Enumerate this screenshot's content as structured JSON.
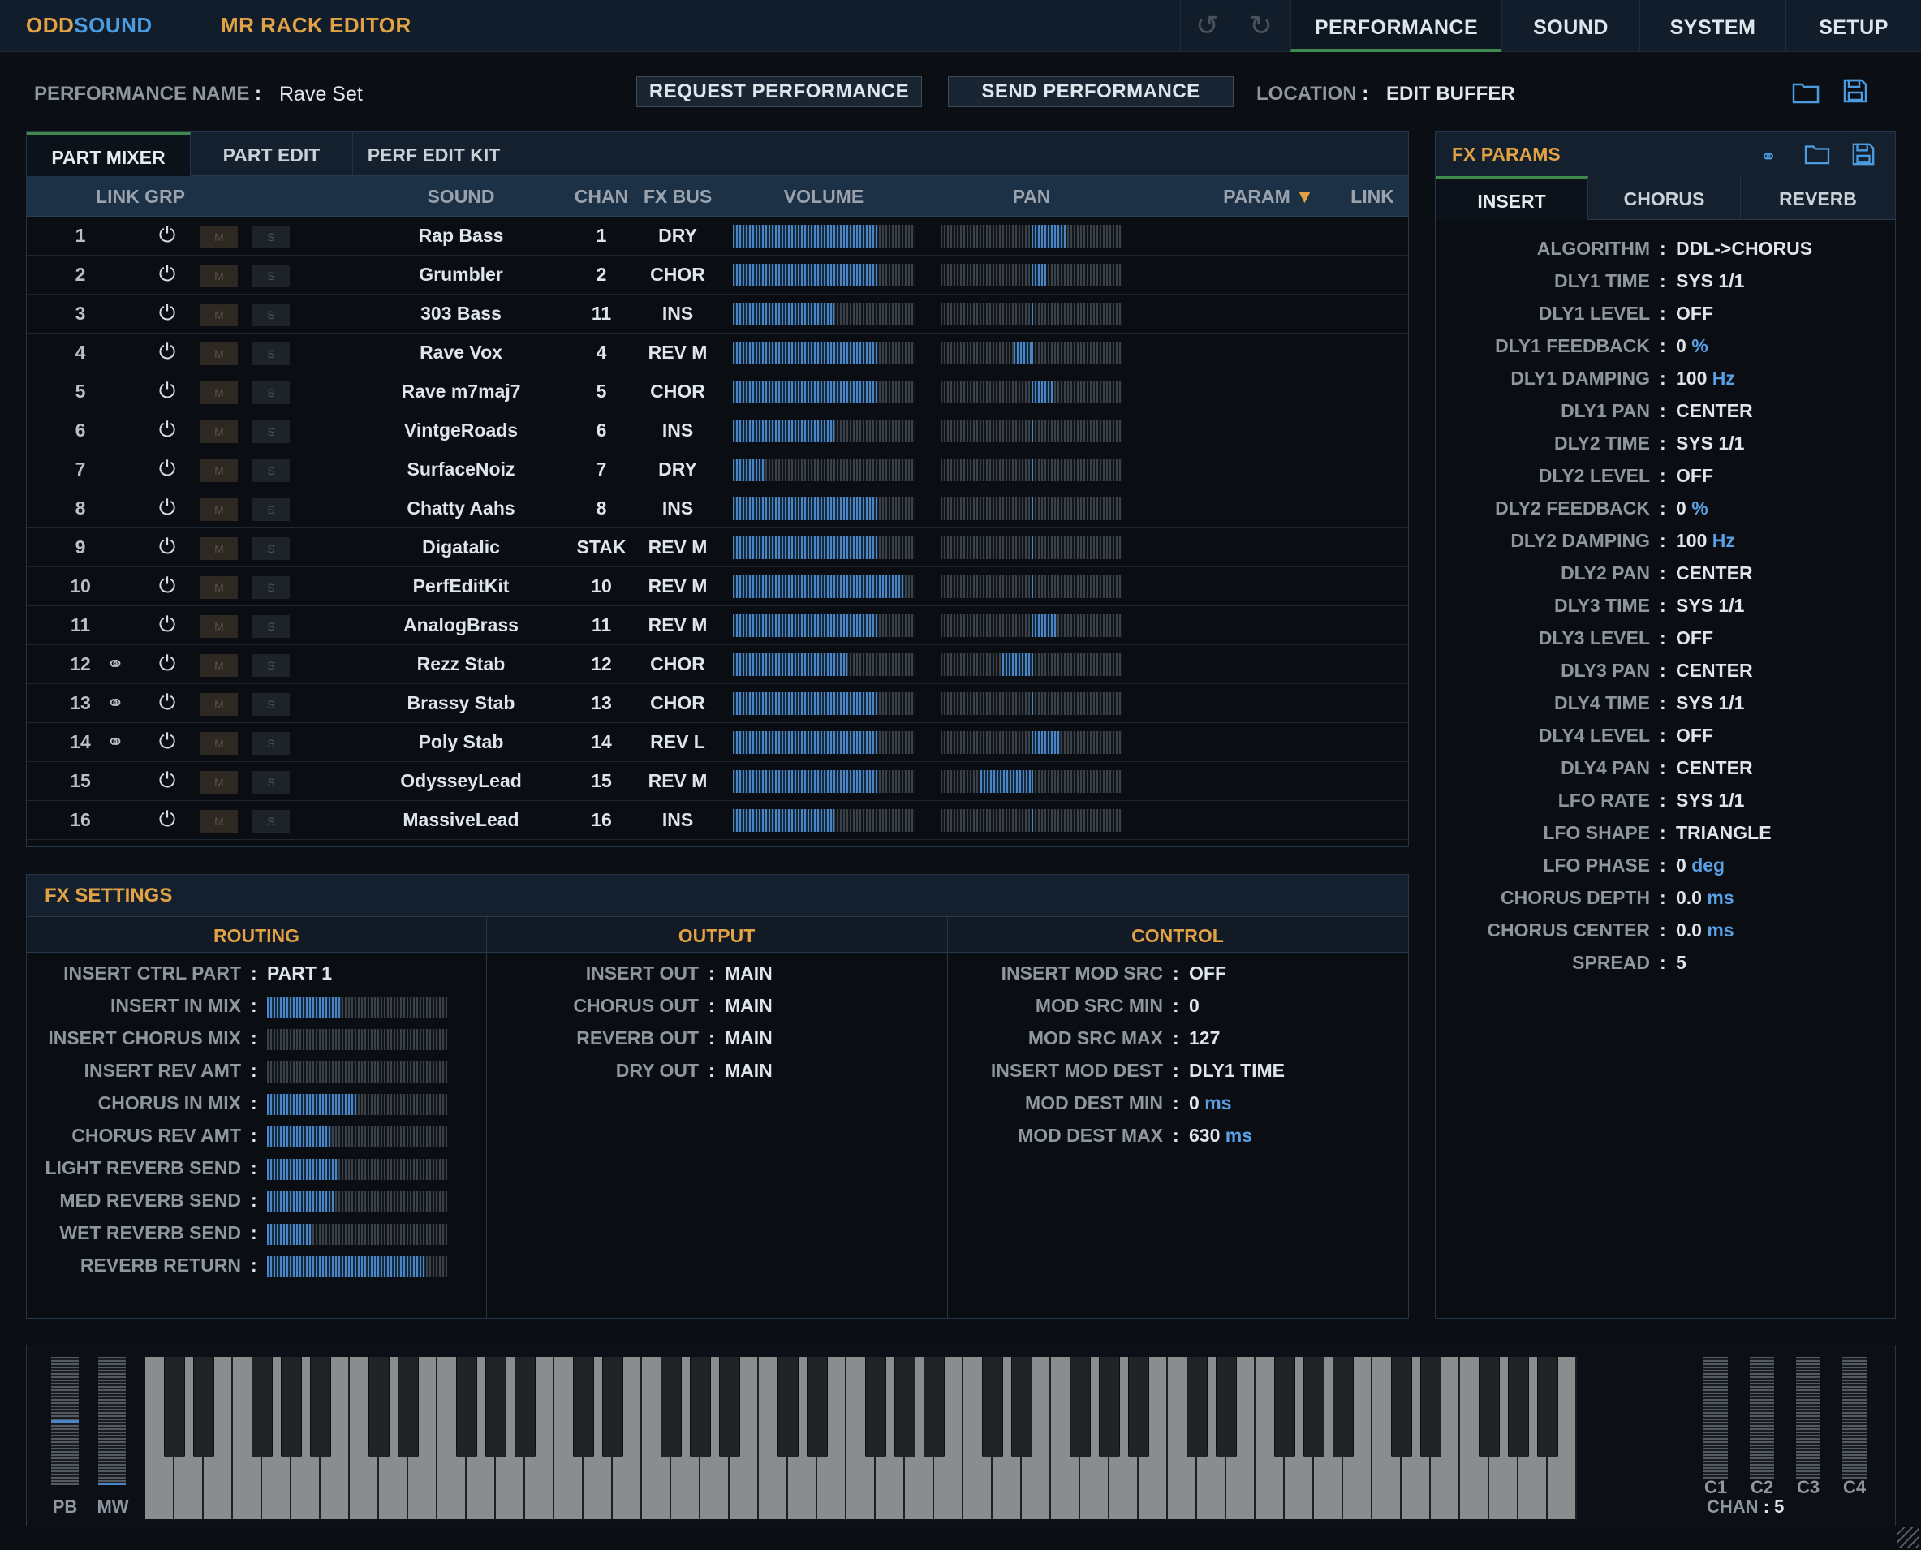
{
  "app": {
    "brand_odd": "ODD",
    "brand_sound": "SOUND",
    "title": "MR RACK EDITOR"
  },
  "nav": {
    "undo_icon": "undo-icon",
    "redo_icon": "redo-icon",
    "tabs": [
      "PERFORMANCE",
      "SOUND",
      "SYSTEM",
      "SETUP"
    ],
    "active": "PERFORMANCE"
  },
  "header": {
    "name_label": "PERFORMANCE NAME",
    "name_value": "Rave Set",
    "request_btn": "REQUEST PERFORMANCE",
    "send_btn": "SEND PERFORMANCE",
    "location_label": "LOCATION",
    "location_value": "EDIT BUFFER",
    "colon": ":"
  },
  "mixer": {
    "tabs": [
      "PART MIXER",
      "PART EDIT",
      "PERF EDIT KIT"
    ],
    "columns": {
      "link_grp": "LINK GRP",
      "sound": "SOUND",
      "chan": "CHAN",
      "fx_bus": "FX BUS",
      "volume": "VOLUME",
      "pan": "PAN",
      "param": "PARAM",
      "link": "LINK"
    },
    "mute_label": "M",
    "solo_label": "S",
    "rows": [
      {
        "num": "1",
        "linked": false,
        "sound": "Rap Bass",
        "chan": "1",
        "bus": "DRY",
        "volume": 0.8,
        "pan": 0.38
      },
      {
        "num": "2",
        "linked": false,
        "sound": "Grumbler",
        "chan": "2",
        "bus": "CHOR",
        "volume": 0.8,
        "pan": 0.16
      },
      {
        "num": "3",
        "linked": false,
        "sound": "303 Bass",
        "chan": "11",
        "bus": "INS",
        "volume": 0.56,
        "pan": 0.0
      },
      {
        "num": "4",
        "linked": false,
        "sound": "Rave Vox",
        "chan": "4",
        "bus": "REV M",
        "volume": 0.8,
        "pan": -0.2
      },
      {
        "num": "5",
        "linked": false,
        "sound": "Rave m7maj7",
        "chan": "5",
        "bus": "CHOR",
        "volume": 0.8,
        "pan": 0.24
      },
      {
        "num": "6",
        "linked": false,
        "sound": "VintgeRoads",
        "chan": "6",
        "bus": "INS",
        "volume": 0.56,
        "pan": 0.0
      },
      {
        "num": "7",
        "linked": false,
        "sound": "SurfaceNoiz",
        "chan": "7",
        "bus": "DRY",
        "volume": 0.18,
        "pan": 0.0
      },
      {
        "num": "8",
        "linked": false,
        "sound": "Chatty Aahs",
        "chan": "8",
        "bus": "INS",
        "volume": 0.8,
        "pan": 0.0
      },
      {
        "num": "9",
        "linked": false,
        "sound": "Digatalic",
        "chan": "STAK",
        "bus": "REV M",
        "volume": 0.8,
        "pan": 0.0
      },
      {
        "num": "10",
        "linked": false,
        "sound": "PerfEditKit",
        "chan": "10",
        "bus": "REV M",
        "volume": 0.94,
        "pan": 0.0
      },
      {
        "num": "11",
        "linked": false,
        "sound": "AnalogBrass",
        "chan": "11",
        "bus": "REV M",
        "volume": 0.8,
        "pan": 0.28
      },
      {
        "num": "12",
        "linked": true,
        "sound": "Rezz Stab",
        "chan": "12",
        "bus": "CHOR",
        "volume": 0.63,
        "pan": -0.32
      },
      {
        "num": "13",
        "linked": true,
        "sound": "Brassy Stab",
        "chan": "13",
        "bus": "CHOR",
        "volume": 0.8,
        "pan": 0.0
      },
      {
        "num": "14",
        "linked": true,
        "sound": "Poly Stab",
        "chan": "14",
        "bus": "REV L",
        "volume": 0.8,
        "pan": 0.32
      },
      {
        "num": "15",
        "linked": false,
        "sound": "OdysseyLead",
        "chan": "15",
        "bus": "REV M",
        "volume": 0.8,
        "pan": -0.56
      },
      {
        "num": "16",
        "linked": false,
        "sound": "MassiveLead",
        "chan": "16",
        "bus": "INS",
        "volume": 0.56,
        "pan": 0.0
      }
    ]
  },
  "fx_settings": {
    "title": "FX SETTINGS",
    "routing": {
      "title": "ROUTING",
      "items": [
        {
          "label": "INSERT CTRL PART",
          "value": "PART 1"
        },
        {
          "label": "INSERT IN MIX",
          "level": 0.42
        },
        {
          "label": "INSERT CHORUS MIX",
          "level": 0.0
        },
        {
          "label": "INSERT REV AMT",
          "level": 0.0
        },
        {
          "label": "CHORUS IN MIX",
          "level": 0.5
        },
        {
          "label": "CHORUS REV AMT",
          "level": 0.36
        },
        {
          "label": "LIGHT REVERB SEND",
          "level": 0.39
        },
        {
          "label": "MED REVERB SEND",
          "level": 0.37
        },
        {
          "label": "WET REVERB SEND",
          "level": 0.25
        },
        {
          "label": "REVERB RETURN",
          "level": 0.88
        }
      ]
    },
    "output": {
      "title": "OUTPUT",
      "items": [
        {
          "label": "INSERT OUT",
          "value": "MAIN"
        },
        {
          "label": "CHORUS OUT",
          "value": "MAIN"
        },
        {
          "label": "REVERB OUT",
          "value": "MAIN"
        },
        {
          "label": "DRY OUT",
          "value": "MAIN"
        }
      ]
    },
    "control": {
      "title": "CONTROL",
      "items": [
        {
          "label": "INSERT MOD SRC",
          "value": "OFF",
          "unit": ""
        },
        {
          "label": "MOD SRC MIN",
          "value": "0",
          "unit": ""
        },
        {
          "label": "MOD SRC MAX",
          "value": "127",
          "unit": ""
        },
        {
          "label": "INSERT MOD DEST",
          "value": "DLY1 TIME",
          "unit": ""
        },
        {
          "label": "MOD DEST MIN",
          "value": "0",
          "unit": "ms"
        },
        {
          "label": "MOD DEST MAX",
          "value": "630",
          "unit": "ms"
        }
      ]
    }
  },
  "fx_params": {
    "title": "FX PARAMS",
    "tabs": [
      "INSERT",
      "CHORUS",
      "REVERB"
    ],
    "items": [
      {
        "label": "ALGORITHM",
        "value": "DDL->CHORUS",
        "unit": ""
      },
      {
        "label": "DLY1 TIME",
        "value": "SYS 1/1",
        "unit": ""
      },
      {
        "label": "DLY1 LEVEL",
        "value": "OFF",
        "unit": ""
      },
      {
        "label": "DLY1 FEEDBACK",
        "value": "0",
        "unit": "%"
      },
      {
        "label": "DLY1 DAMPING",
        "value": "100",
        "unit": "Hz"
      },
      {
        "label": "DLY1 PAN",
        "value": "CENTER",
        "unit": ""
      },
      {
        "label": "DLY2 TIME",
        "value": "SYS 1/1",
        "unit": ""
      },
      {
        "label": "DLY2 LEVEL",
        "value": "OFF",
        "unit": ""
      },
      {
        "label": "DLY2 FEEDBACK",
        "value": "0",
        "unit": "%"
      },
      {
        "label": "DLY2 DAMPING",
        "value": "100",
        "unit": "Hz"
      },
      {
        "label": "DLY2 PAN",
        "value": "CENTER",
        "unit": ""
      },
      {
        "label": "DLY3 TIME",
        "value": "SYS 1/1",
        "unit": ""
      },
      {
        "label": "DLY3 LEVEL",
        "value": "OFF",
        "unit": ""
      },
      {
        "label": "DLY3 PAN",
        "value": "CENTER",
        "unit": ""
      },
      {
        "label": "DLY4 TIME",
        "value": "SYS 1/1",
        "unit": ""
      },
      {
        "label": "DLY4 LEVEL",
        "value": "OFF",
        "unit": ""
      },
      {
        "label": "DLY4 PAN",
        "value": "CENTER",
        "unit": ""
      },
      {
        "label": "LFO RATE",
        "value": "SYS 1/1",
        "unit": ""
      },
      {
        "label": "LFO SHAPE",
        "value": "TRIANGLE",
        "unit": ""
      },
      {
        "label": "LFO PHASE",
        "value": "0",
        "unit": "deg"
      },
      {
        "label": "CHORUS DEPTH",
        "value": "0.0",
        "unit": "ms"
      },
      {
        "label": "CHORUS CENTER",
        "value": "0.0",
        "unit": "ms"
      },
      {
        "label": "SPREAD",
        "value": "5",
        "unit": ""
      }
    ]
  },
  "keyboard": {
    "pb_label": "PB",
    "mw_label": "MW",
    "pb_level": 0.5,
    "mw_level": 0.0,
    "controls": [
      "C1",
      "C2",
      "C3",
      "C4"
    ],
    "chan_label": "CHAN",
    "chan_value": "5",
    "white_keys": 49
  },
  "colors": {
    "accent_orange": "#e1a245",
    "brand_blue": "#4a9be0",
    "bar_blue": "#4a86c6",
    "active_tab_green": "#3f8a4d"
  }
}
